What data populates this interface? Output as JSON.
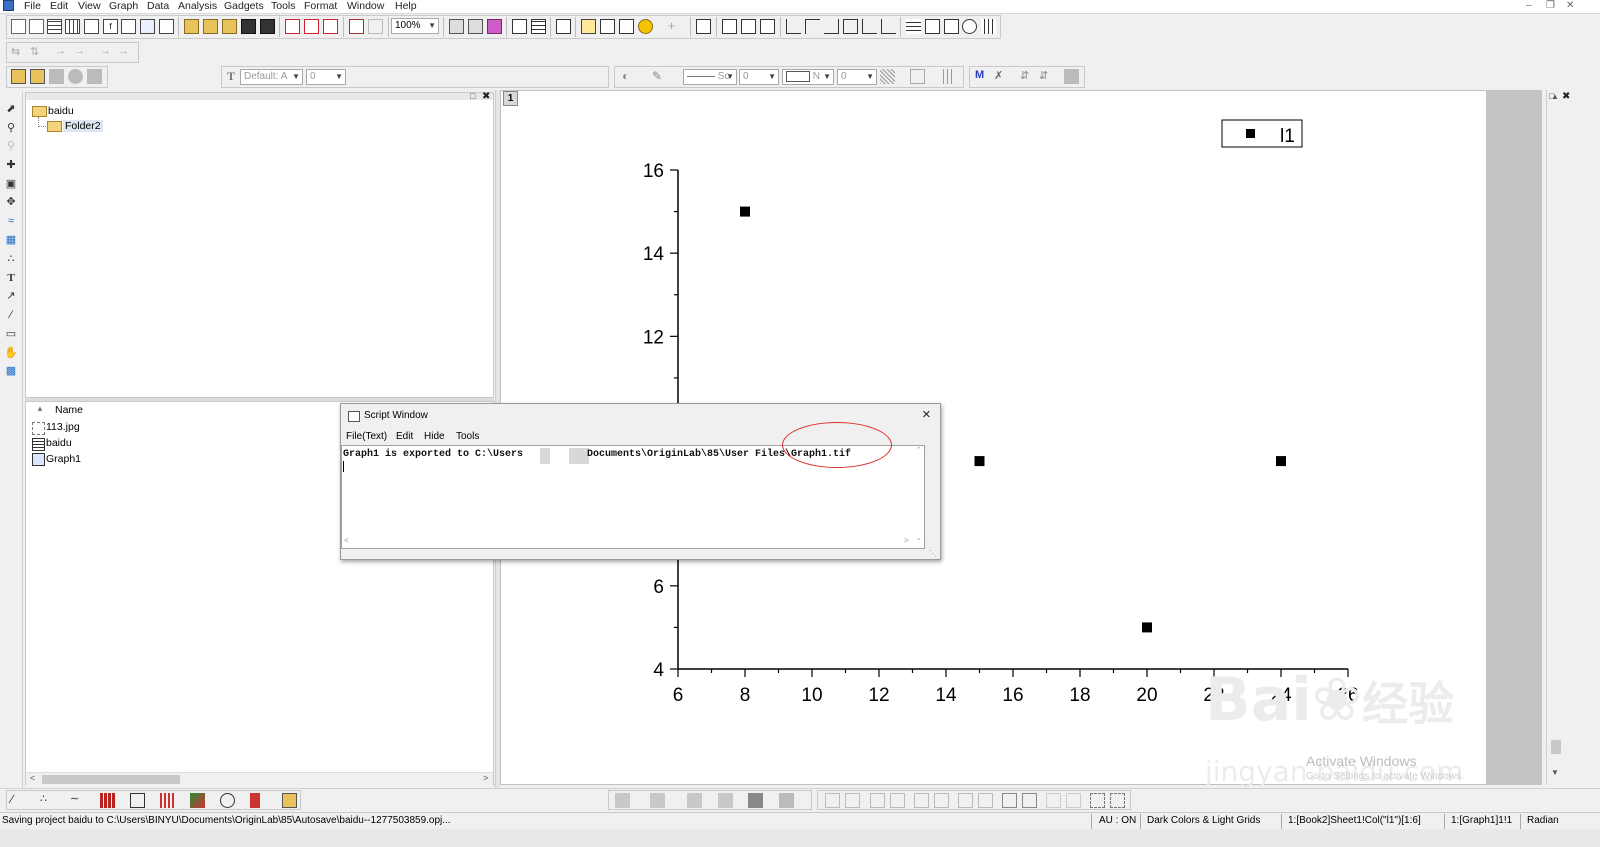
{
  "menu": [
    "File",
    "Edit",
    "View",
    "Graph",
    "Data",
    "Analysis",
    "Gadgets",
    "Tools",
    "Format",
    "Window",
    "Help"
  ],
  "toolbar": {
    "zoom": "100%",
    "font_name": "Default: A",
    "font_size": "0",
    "line_style": "Sc",
    "line_width": "0",
    "fill_label": "N",
    "fill_width": "0"
  },
  "project_explorer": {
    "root": "baidu",
    "child": "Folder2",
    "column_header": "Name",
    "files": [
      {
        "name": "113.jpg",
        "icon": "image-file-icon"
      },
      {
        "name": "baidu",
        "icon": "workbook-icon"
      },
      {
        "name": "Graph1",
        "icon": "graph-file-icon"
      }
    ]
  },
  "graph": {
    "layer_label": "1",
    "legend_label": "l1",
    "annotation_color": "#d9302c"
  },
  "chart_data": {
    "type": "scatter",
    "title": "",
    "xlabel": "",
    "ylabel": "",
    "xlim": [
      6,
      26
    ],
    "ylim": [
      4,
      16
    ],
    "x_ticks": [
      6,
      8,
      10,
      12,
      14,
      16,
      18,
      20,
      22,
      24,
      26
    ],
    "y_ticks": [
      4,
      6,
      12,
      14,
      16
    ],
    "legend": "top-right",
    "grid": false,
    "series": [
      {
        "name": "l1",
        "x": [
          8,
          15,
          20,
          24
        ],
        "y": [
          15,
          9,
          5,
          9
        ],
        "marker": "square",
        "color": "#000000"
      }
    ]
  },
  "script_window": {
    "title": "Script Window",
    "menu": [
      "File(Text)",
      "Edit",
      "Hide",
      "Tools"
    ],
    "output_line_1": "Graph1 is exported to C:\\Users",
    "output_line_2": "Documents\\OriginLab\\85\\User Files\\Graph1.tif"
  },
  "status": {
    "message": "Saving project baidu to C:\\Users\\BINYU\\Documents\\OriginLab\\85\\Autosave\\baidu--1277503859.opj...",
    "au": "AU : ON",
    "theme": "Dark Colors & Light Grids",
    "book_ref": "1:[Book2]Sheet1!Col(\"l1\")[1:6]",
    "graph_ref": "1:[Graph1]1!1",
    "angle": "Radian"
  },
  "watermark": {
    "brand": "Bai",
    "brand_cn": "经验",
    "site": "jingyan.baidu.com",
    "activate_title": "Activate Windows",
    "activate_sub": "Go to Settings to activate Windows."
  }
}
